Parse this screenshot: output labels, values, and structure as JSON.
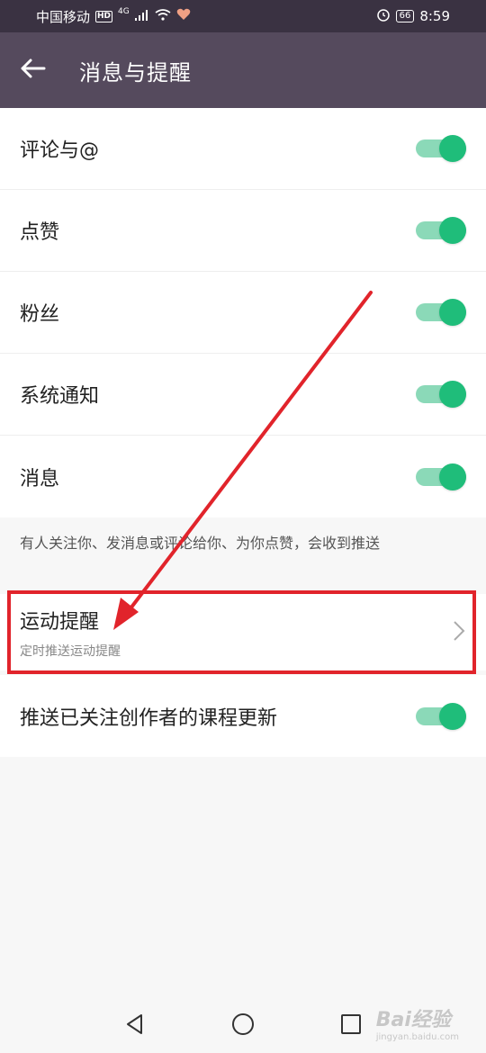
{
  "status_bar": {
    "carrier": "中国移动",
    "hd": "HD",
    "network": "4G",
    "battery": "66",
    "time": "8:59"
  },
  "header": {
    "title": "消息与提醒"
  },
  "toggles": [
    {
      "label": "评论与@",
      "on": true
    },
    {
      "label": "点赞",
      "on": true
    },
    {
      "label": "粉丝",
      "on": true
    },
    {
      "label": "系统通知",
      "on": true
    },
    {
      "label": "消息",
      "on": true
    }
  ],
  "note": "有人关注你、发消息或评论给你、为你点赞，会收到推送",
  "sport_reminder": {
    "title": "运动提醒",
    "subtitle": "定时推送运动提醒"
  },
  "course_update": {
    "label": "推送已关注创作者的课程更新",
    "on": true
  },
  "colors": {
    "header_bg": "#554a5d",
    "status_bg": "#3a3242",
    "toggle_on": "#1fbd7a",
    "annotation_red": "#e1242b"
  },
  "watermark": {
    "brand": "Bai经验",
    "url": "jingyan.baidu.com"
  }
}
